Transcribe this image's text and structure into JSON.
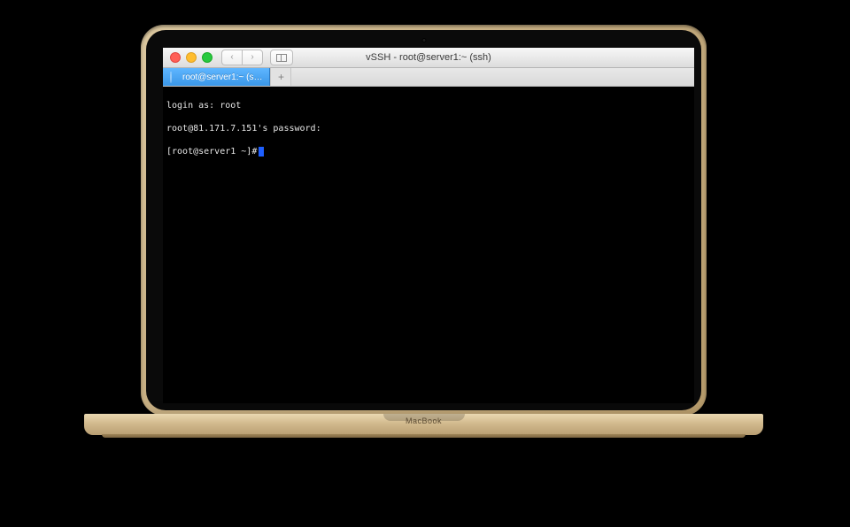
{
  "device": {
    "label": "MacBook"
  },
  "window": {
    "title": "vSSH - root@server1:~ (ssh)"
  },
  "tabs": {
    "active_label": "root@server1:~ (s…",
    "new_tab_glyph": "+"
  },
  "nav": {
    "back_glyph": "‹",
    "forward_glyph": "›"
  },
  "terminal": {
    "line1": "login as: root",
    "line2": "root@81.171.7.151's password:",
    "line3_prompt": "[root@server1 ~]#"
  }
}
